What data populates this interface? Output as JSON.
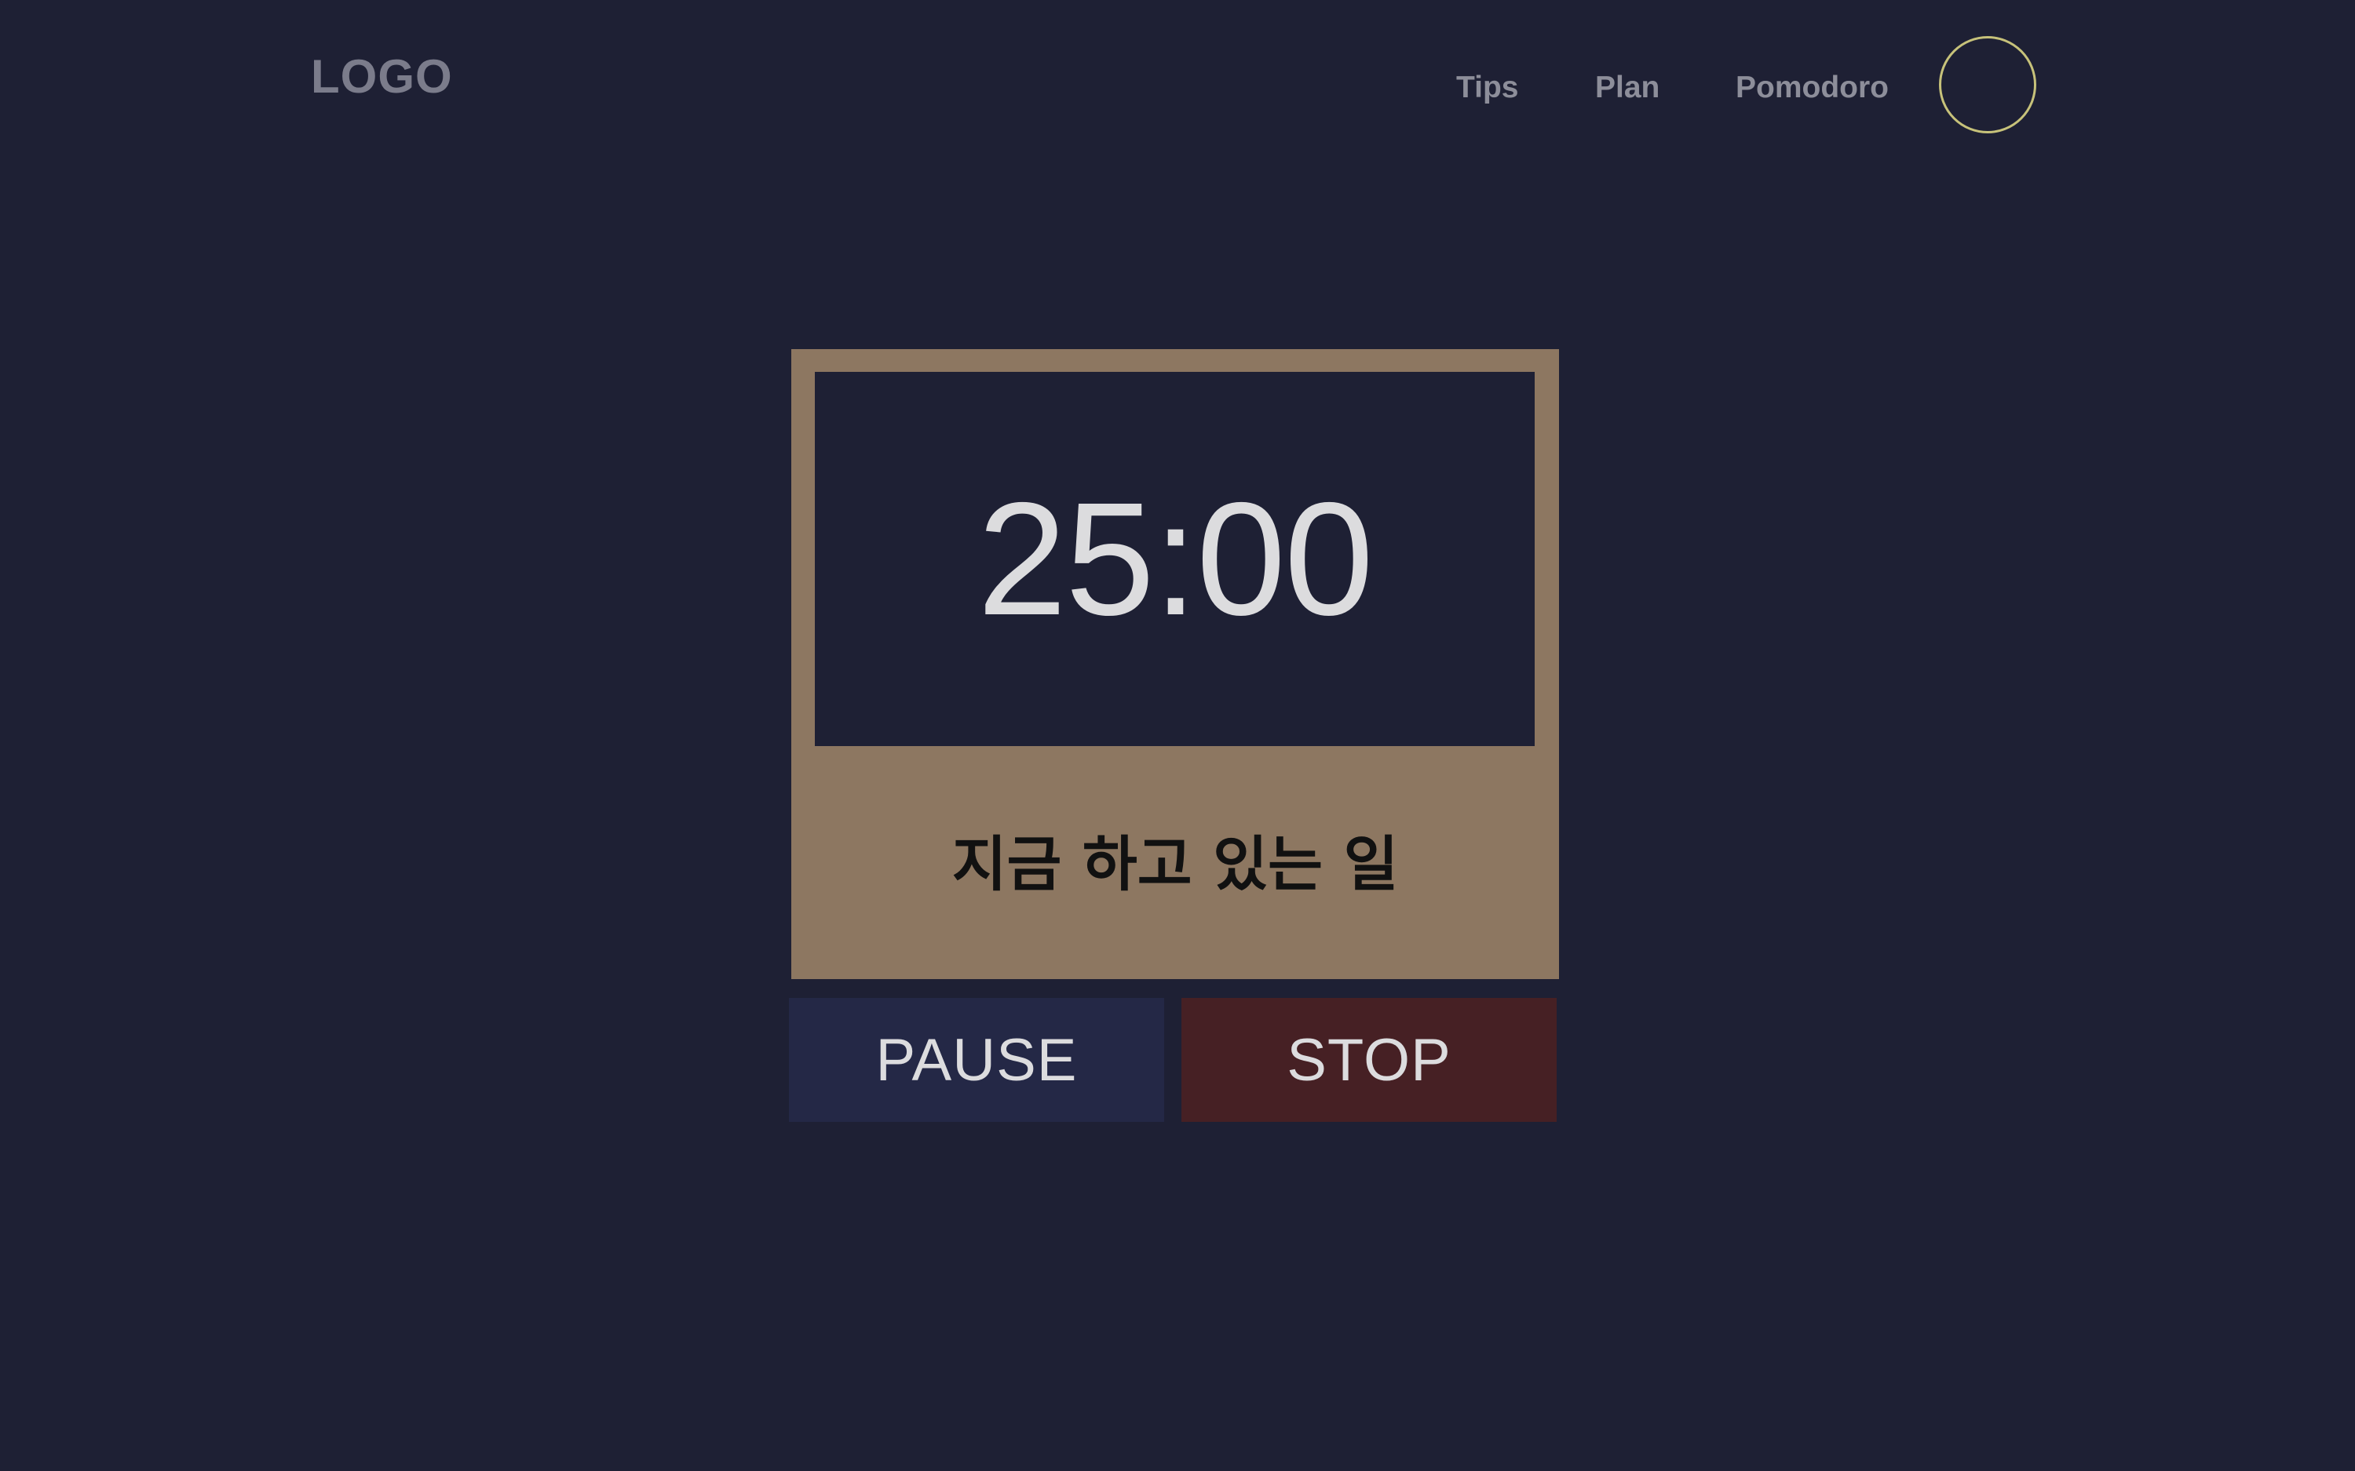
{
  "header": {
    "logo": "LOGO",
    "nav": [
      {
        "label": "Tips"
      },
      {
        "label": "Plan"
      },
      {
        "label": "Pomodoro"
      }
    ]
  },
  "timer": {
    "display": "25:00",
    "task": "지금 하고 있는 일"
  },
  "controls": {
    "pause_label": "PAUSE",
    "stop_label": "STOP"
  },
  "colors": {
    "background": "#1e2034",
    "card": "#8d7761",
    "pause_button": "#242846",
    "stop_button": "#462024",
    "avatar_ring": "#c7c27a"
  }
}
